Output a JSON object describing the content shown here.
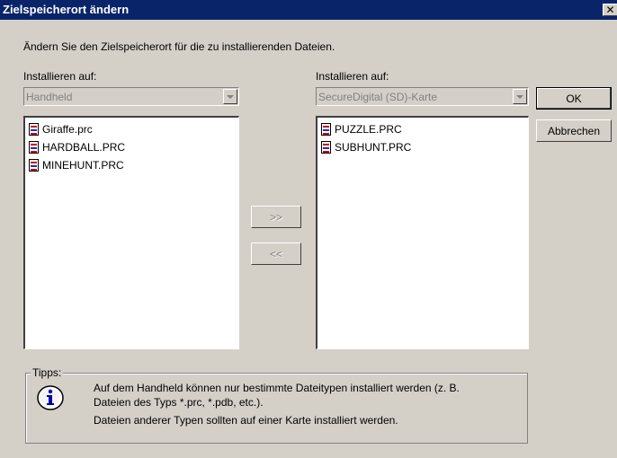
{
  "window": {
    "title": "Zielspeicherort ändern",
    "close_glyph": "✕"
  },
  "description": "Ändern Sie den Zielspeicherort für die zu installierenden Dateien.",
  "left": {
    "label": "Installieren auf:",
    "selected": "Handheld",
    "files": [
      "Giraffe.prc",
      "HARDBALL.PRC",
      "MINEHUNT.PRC"
    ]
  },
  "right": {
    "label": "Installieren auf:",
    "selected": "SecureDigital (SD)-Karte",
    "files": [
      "PUZZLE.PRC",
      "SUBHUNT.PRC"
    ]
  },
  "buttons": {
    "move_right": ">>",
    "move_left": "<<",
    "ok": "OK",
    "cancel": "Abbrechen"
  },
  "tips": {
    "legend": "Tipps:",
    "line1": "Auf dem Handheld können nur bestimmte Dateitypen installiert werden (z. B.",
    "line2": "Dateien des Typs *.prc, *.pdb, etc.).",
    "line3": "Dateien anderer Typen sollten auf einer Karte installiert werden."
  },
  "icons": {
    "file": "palm-file-icon",
    "info": "info-icon",
    "dropdown": "chevron-down-icon"
  },
  "colors": {
    "titlebar": "#0a246a",
    "face": "#d4d0c8"
  }
}
